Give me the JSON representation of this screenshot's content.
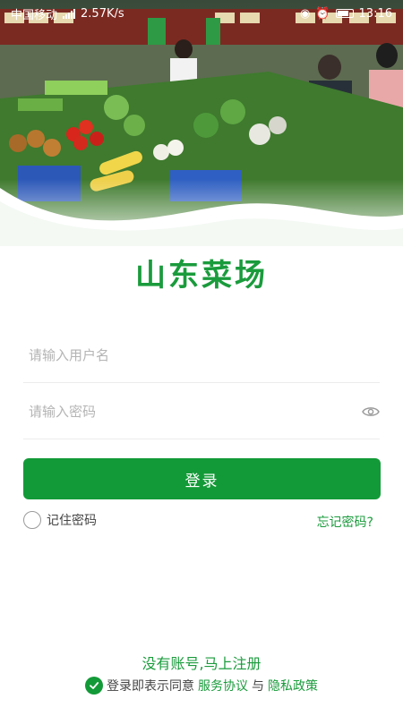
{
  "status_bar": {
    "carrier": "中国移动",
    "network_speed": "2.57K/s",
    "time": "13:16"
  },
  "hero": {
    "image_desc": "market-vegetable-stall-photo"
  },
  "app_title": "山东菜场",
  "form": {
    "username_placeholder": "请输入用户名",
    "password_placeholder": "请输入密码",
    "login_label": "登录",
    "remember_label": "记住密码",
    "forgot_label": "忘记密码?"
  },
  "footer": {
    "register_label": "没有账号,马上注册",
    "agreement_prefix": "登录即表示同意",
    "service_agreement": "服务协议",
    "conjunction": "与",
    "privacy_policy": "隐私政策"
  },
  "colors": {
    "brand_green": "#139a38",
    "link_green": "#1a9b3c"
  }
}
